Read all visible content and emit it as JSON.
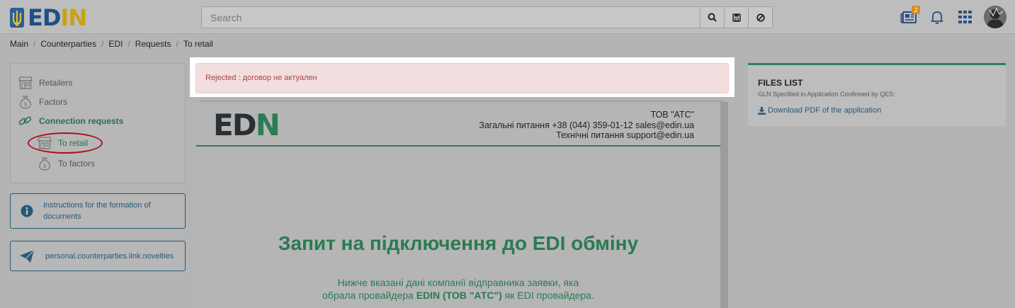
{
  "app": {
    "logo_left": "ED",
    "logo_right": "IN"
  },
  "search": {
    "placeholder": "Search"
  },
  "header": {
    "news_badge": "2"
  },
  "breadcrumbs": [
    "Main",
    "Counterparties",
    "EDI",
    "Requests",
    "To retail"
  ],
  "sidebar": {
    "items": [
      {
        "label": "Retailers",
        "icon": "store-icon"
      },
      {
        "label": "Factors",
        "icon": "money-bag-icon"
      },
      {
        "label": "Connection requests",
        "icon": "link-icon"
      },
      {
        "label": "To retail",
        "icon": "store-icon"
      },
      {
        "label": "To factors",
        "icon": "money-bag-icon"
      }
    ],
    "instructions_label": "Instructions for the formation of documents",
    "novelties_label": "personal.counterparties.link.novelties"
  },
  "alert": {
    "text": "Rejected : договор не актуален"
  },
  "document": {
    "logo_left": "ED",
    "logo_right": "N",
    "company": "ТОВ \"АТС\"",
    "contact_general": "Загальні питання +38 (044) 359-01-12 sales@edin.ua",
    "contact_tech": "Технічні питання support@edin.ua",
    "title": "Запит на підключення до EDI обміну",
    "subtitle_line1": "Нижче вказані дані компанії відправника заявки, яка",
    "subtitle_line2_pre": "обрала провайдера ",
    "subtitle_line2_bold": "EDIN (ТОВ \"АТС\")",
    "subtitle_line2_post": " як EDI провайдера."
  },
  "files": {
    "title": "FILES LIST",
    "subtitle": "GLN Specified in Application Confirmed by QES:",
    "download_label": "Download PDF of the application"
  },
  "colors": {
    "accent_green": "#2b7d55",
    "link_blue": "#28577a",
    "alert_red": "#a94442",
    "highlight_circle": "#b00f17"
  }
}
